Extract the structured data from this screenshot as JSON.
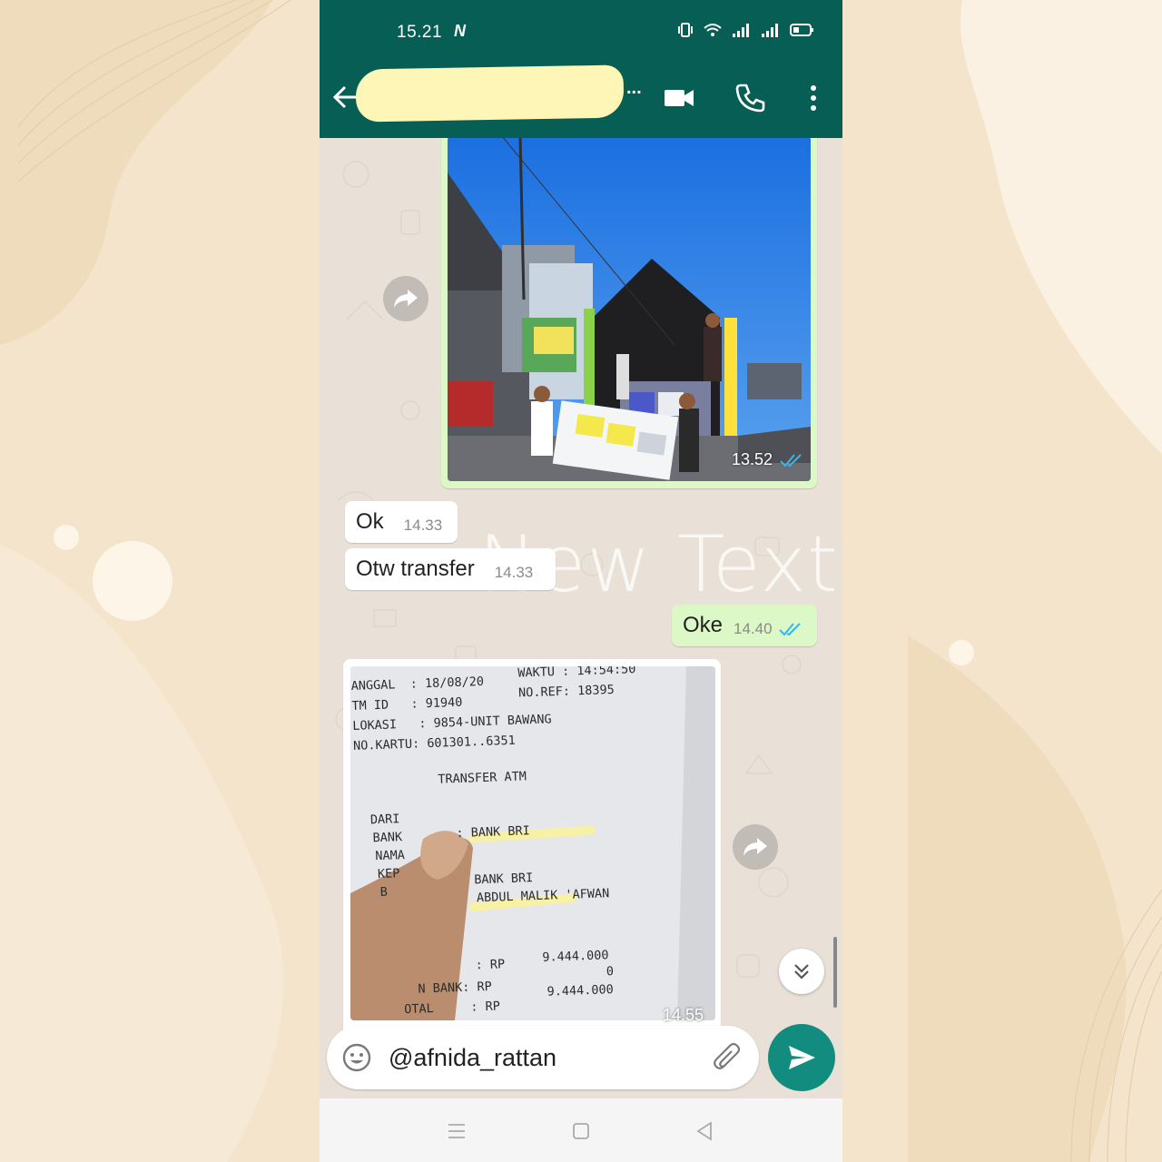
{
  "status_bar": {
    "time": "15.21",
    "notification_icon": "N"
  },
  "header": {
    "contact_name": "",
    "more_label": "...",
    "icons": [
      "back-arrow-icon",
      "video-call-icon",
      "voice-call-icon",
      "more-options-icon"
    ]
  },
  "messages": [
    {
      "type": "image",
      "direction": "out",
      "time": "13.52",
      "status": "read"
    },
    {
      "type": "text",
      "direction": "in",
      "text": "Ok",
      "time": "14.33"
    },
    {
      "type": "text",
      "direction": "in",
      "text": "Otw transfer",
      "time": "14.33"
    },
    {
      "type": "text",
      "direction": "out",
      "text": "Oke",
      "time": "14.40",
      "status": "read"
    },
    {
      "type": "image",
      "direction": "in",
      "time": "14.55",
      "receipt": {
        "line1a": "ANGGAL  : 18/08/20",
        "line1b": "WAKTU : 14:54:50",
        "line2a": "TM ID   : 91940",
        "line2b": "NO.REF: 18395",
        "line3": "LOKASI   : 9854-UNIT BAWANG",
        "line4": "NO.KARTU: 601301..6351",
        "title": "TRANSFER ATM",
        "labels": [
          "DARI",
          "BANK",
          "NAMA",
          "KEP",
          "B"
        ],
        "from_bank": ": BANK BRI",
        "to_bank": "BANK BRI",
        "to_name": "ABDUL MALIK 'AFWAN",
        "amount_label": ": RP",
        "amount": "9.444.000",
        "fee_label": "N BANK: RP",
        "fee": "0",
        "total_label": "OTAL     : RP",
        "total": "9.444.000"
      }
    }
  ],
  "watermark": "New Text",
  "input": {
    "value": "@afnida_rattan"
  },
  "colors": {
    "header": "#075e54",
    "accent": "#128c7e",
    "outgoing_bubble": "#dcf8c6",
    "read_ticks": "#34b7f1"
  }
}
